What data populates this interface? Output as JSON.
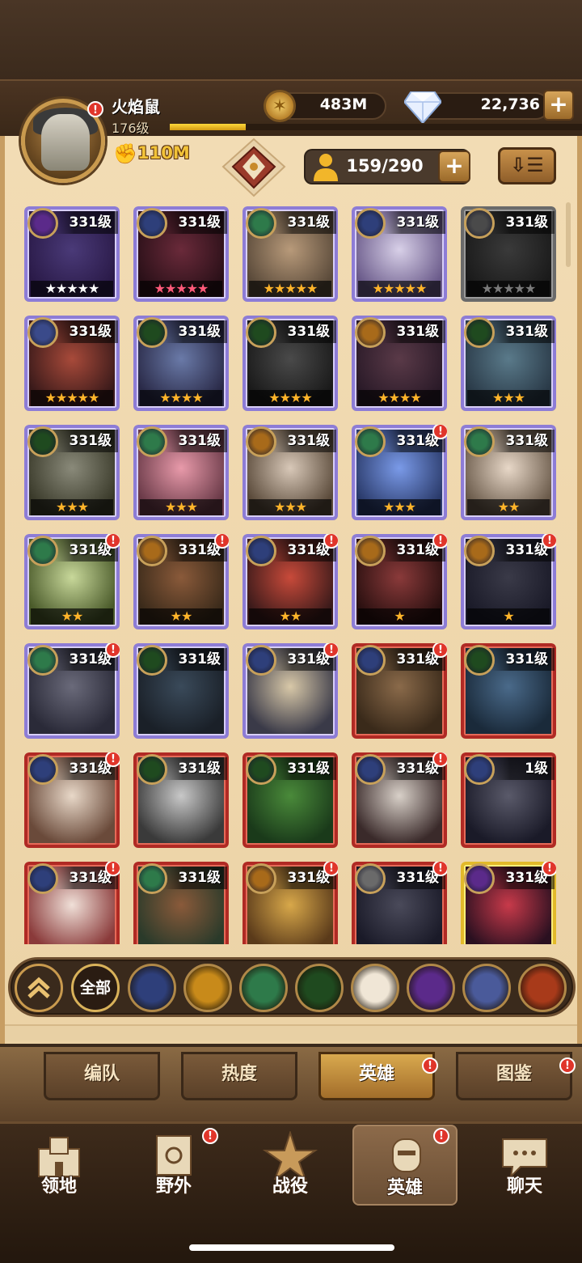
{
  "header": {
    "player_name": "火焰鼠",
    "player_level": "176级",
    "xp_fraction": 0.18,
    "power": "110M",
    "gold": "483M",
    "diamonds": "22,736"
  },
  "roster": {
    "count": "159/290"
  },
  "heroes": [
    {
      "level": "331级",
      "stars": "★★★★★",
      "star_color": "white",
      "frame": "purple",
      "faction": "#5b2a8a",
      "art": [
        "#4a3a78",
        "#2a1a48"
      ],
      "alert": false
    },
    {
      "level": "331级",
      "stars": "★★★★★",
      "star_color": "pink",
      "frame": "purple",
      "faction": "#2e3f7a",
      "art": [
        "#6a2a3a",
        "#2a1018"
      ],
      "alert": false
    },
    {
      "level": "331级",
      "stars": "★★★★★",
      "star_color": "gold",
      "frame": "purple",
      "faction": "#2e7a4a",
      "art": [
        "#b89a7a",
        "#5a4a3a"
      ],
      "alert": false
    },
    {
      "level": "331级",
      "stars": "★★★★★",
      "star_color": "gold",
      "frame": "purple",
      "faction": "#2e3f7a",
      "art": [
        "#d8d0e8",
        "#6a5a8a"
      ],
      "alert": false
    },
    {
      "level": "331级",
      "stars": "★★★★★",
      "star_color": "gray",
      "frame": "gray",
      "faction": "#4a4a4a",
      "art": [
        "#3a3a3a",
        "#1a1a1a"
      ],
      "alert": false
    },
    {
      "level": "331级",
      "stars": "★★★★★",
      "star_color": "gold",
      "frame": "purple",
      "faction": "#3a4a8a",
      "art": [
        "#a84a3a",
        "#3a1a1a"
      ],
      "alert": false
    },
    {
      "level": "331级",
      "stars": "★★★★",
      "star_color": "gold",
      "frame": "purple",
      "faction": "#1f4a1f",
      "art": [
        "#6a7aa8",
        "#2a2a48"
      ],
      "alert": false
    },
    {
      "level": "331级",
      "stars": "★★★★",
      "star_color": "gold",
      "frame": "purple",
      "faction": "#1f4a1f",
      "art": [
        "#4a4a4a",
        "#1a1a1a"
      ],
      "alert": false
    },
    {
      "level": "331级",
      "stars": "★★★★",
      "star_color": "gold",
      "frame": "purple",
      "faction": "#a86a1a",
      "art": [
        "#5a3a48",
        "#2a1a28"
      ],
      "alert": false
    },
    {
      "level": "331级",
      "stars": "★★★",
      "star_color": "gold",
      "frame": "purple",
      "faction": "#1f4a1f",
      "art": [
        "#5a7a8a",
        "#2a3a48"
      ],
      "alert": false
    },
    {
      "level": "331级",
      "stars": "★★★",
      "star_color": "gold",
      "frame": "purple",
      "faction": "#1f4a1f",
      "art": [
        "#8a8a7a",
        "#3a3a2a"
      ],
      "alert": false
    },
    {
      "level": "331级",
      "stars": "★★★",
      "star_color": "gold",
      "frame": "purple",
      "faction": "#2e7a4a",
      "art": [
        "#e89aaa",
        "#6a3a48"
      ],
      "alert": false
    },
    {
      "level": "331级",
      "stars": "★★★",
      "star_color": "gold",
      "frame": "purple",
      "faction": "#a86a1a",
      "art": [
        "#d8c8b8",
        "#5a4a3a"
      ],
      "alert": false
    },
    {
      "level": "331级",
      "stars": "★★★",
      "star_color": "gold",
      "frame": "purple",
      "faction": "#2e7a4a",
      "art": [
        "#7a9ae8",
        "#2a3a6a"
      ],
      "alert": true
    },
    {
      "level": "331级",
      "stars": "★★",
      "star_color": "gold",
      "frame": "purple",
      "faction": "#2e7a4a",
      "art": [
        "#e8d8c8",
        "#6a5a4a"
      ],
      "alert": false
    },
    {
      "level": "331级",
      "stars": "★★",
      "star_color": "gold",
      "frame": "purple",
      "faction": "#2e7a4a",
      "art": [
        "#c8d89a",
        "#4a5a2a"
      ],
      "alert": true
    },
    {
      "level": "331级",
      "stars": "★★",
      "star_color": "gold",
      "frame": "purple",
      "faction": "#a86a1a",
      "art": [
        "#8a5a3a",
        "#3a2a1a"
      ],
      "alert": true
    },
    {
      "level": "331级",
      "stars": "★★",
      "star_color": "gold",
      "frame": "purple",
      "faction": "#2e3f7a",
      "art": [
        "#c84a3a",
        "#3a1a1a"
      ],
      "alert": true
    },
    {
      "level": "331级",
      "stars": "★",
      "star_color": "gold",
      "frame": "purple",
      "faction": "#a86a1a",
      "art": [
        "#8a3a3a",
        "#2a1010"
      ],
      "alert": true
    },
    {
      "level": "331级",
      "stars": "★",
      "star_color": "gold",
      "frame": "purple",
      "faction": "#a86a1a",
      "art": [
        "#3a3a48",
        "#1a1a28"
      ],
      "alert": true
    },
    {
      "level": "331级",
      "stars": "",
      "star_color": "gold",
      "frame": "purple",
      "faction": "#2e7a4a",
      "art": [
        "#6a6a7a",
        "#2a2a38"
      ],
      "alert": true
    },
    {
      "level": "331级",
      "stars": "",
      "star_color": "gold",
      "frame": "purple",
      "faction": "#1f4a1f",
      "art": [
        "#3a4a5a",
        "#1a2028"
      ],
      "alert": false
    },
    {
      "level": "331级",
      "stars": "",
      "star_color": "gold",
      "frame": "purple",
      "faction": "#2e3f7a",
      "art": [
        "#d8c8a8",
        "#3a3a48"
      ],
      "alert": true
    },
    {
      "level": "331级",
      "stars": "",
      "star_color": "gold",
      "frame": "red",
      "faction": "#2e3f7a",
      "art": [
        "#8a6a4a",
        "#3a2a1a"
      ],
      "alert": true
    },
    {
      "level": "331级",
      "stars": "",
      "star_color": "gold",
      "frame": "red",
      "faction": "#1f4a1f",
      "art": [
        "#4a6a8a",
        "#1a2a3a"
      ],
      "alert": false
    },
    {
      "level": "331级",
      "stars": "",
      "star_color": "gold",
      "frame": "red",
      "faction": "#2e3f7a",
      "art": [
        "#e8d8c8",
        "#6a4a3a"
      ],
      "alert": true
    },
    {
      "level": "331级",
      "stars": "",
      "star_color": "gold",
      "frame": "red",
      "faction": "#1f4a1f",
      "art": [
        "#c8c8c8",
        "#3a3a3a"
      ],
      "alert": false
    },
    {
      "level": "331级",
      "stars": "",
      "star_color": "gold",
      "frame": "red",
      "faction": "#1f4a1f",
      "art": [
        "#4a8a3a",
        "#1a3a1a"
      ],
      "alert": false
    },
    {
      "level": "331级",
      "stars": "",
      "star_color": "gold",
      "frame": "red",
      "faction": "#2e3f7a",
      "art": [
        "#d8d0c8",
        "#3a2a2a"
      ],
      "alert": true
    },
    {
      "level": "1级",
      "stars": "",
      "star_color": "gold",
      "frame": "red",
      "faction": "#2e3f7a",
      "art": [
        "#5a5a6a",
        "#1a1a28"
      ],
      "alert": false
    },
    {
      "level": "331级",
      "stars": "",
      "star_color": "gold",
      "frame": "red",
      "faction": "#2e3f7a",
      "art": [
        "#f0e0d8",
        "#8a3a3a"
      ],
      "alert": true
    },
    {
      "level": "331级",
      "stars": "",
      "star_color": "gold",
      "frame": "red",
      "faction": "#2e7a4a",
      "art": [
        "#8a5a3a",
        "#2a3a2a"
      ],
      "alert": false
    },
    {
      "level": "331级",
      "stars": "",
      "star_color": "gold",
      "frame": "red",
      "faction": "#a86a1a",
      "art": [
        "#d8a84a",
        "#5a3a1a"
      ],
      "alert": true
    },
    {
      "level": "331级",
      "stars": "",
      "star_color": "gold",
      "frame": "red",
      "faction": "#6a6a6a",
      "art": [
        "#4a4a5a",
        "#1a1a28"
      ],
      "alert": true
    },
    {
      "level": "331级",
      "stars": "",
      "star_color": "gold",
      "frame": "gold",
      "faction": "#5b2a8a",
      "art": [
        "#c83a4a",
        "#2a1020"
      ],
      "alert": true
    }
  ],
  "filters": {
    "all_label": "全部",
    "factions": [
      {
        "name": "lightbearer-icon",
        "color": "#2e3f7a"
      },
      {
        "name": "mauler-icon",
        "color": "#c88a1a"
      },
      {
        "name": "wilder-icon",
        "color": "#2e7a4a"
      },
      {
        "name": "graveborn-icon",
        "color": "#1f4a1f"
      },
      {
        "name": "celestial-icon",
        "color": "#f0e6d6"
      },
      {
        "name": "hypogean-icon",
        "color": "#5b2a8a"
      },
      {
        "name": "dimensional-icon",
        "color": "#4a5a9a"
      },
      {
        "name": "draconis-icon",
        "color": "#a83a1a"
      }
    ]
  },
  "subtabs": [
    {
      "label": "编队",
      "active": false,
      "alert": false
    },
    {
      "label": "热度",
      "active": false,
      "alert": false
    },
    {
      "label": "英雄",
      "active": true,
      "alert": true
    },
    {
      "label": "图鉴",
      "active": false,
      "alert": true
    }
  ],
  "nav": [
    {
      "label": "领地",
      "active": false,
      "alert": false
    },
    {
      "label": "野外",
      "active": false,
      "alert": true
    },
    {
      "label": "战役",
      "active": false,
      "alert": false
    },
    {
      "label": "英雄",
      "active": true,
      "alert": true
    },
    {
      "label": "聊天",
      "active": false,
      "alert": false
    }
  ],
  "alert_mark": "!"
}
